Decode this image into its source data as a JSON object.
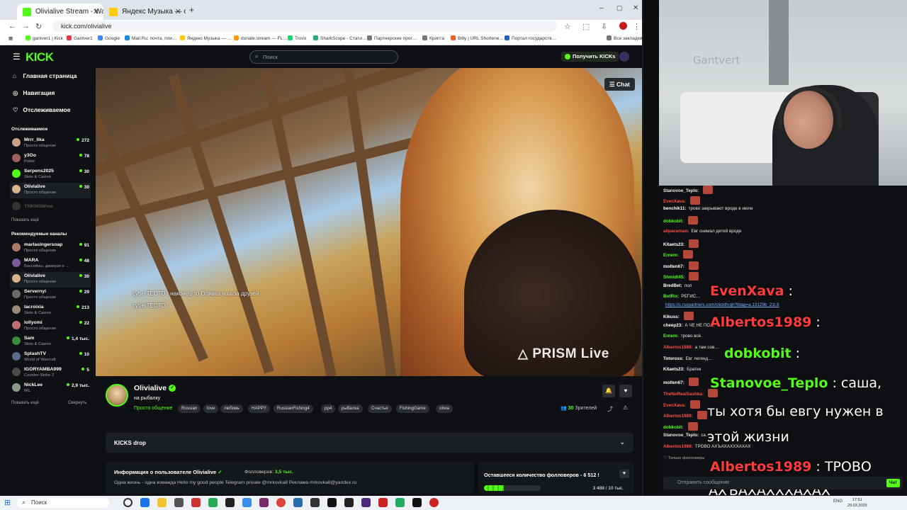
{
  "browser": {
    "tabs": [
      {
        "title": "Olivialive Stream - Watch Live …",
        "active": true
      },
      {
        "title": "Яндекс Музыка — собираем …",
        "active": false
      }
    ],
    "url": "kick.com/olivialive",
    "bookmarks": [
      "gantver1 | Kick",
      "Gantver1",
      "Google",
      "Mail.Ru: почта, пои…",
      "Яндекс Музыка — …",
      "donate.stream — FL…",
      "Trovo",
      "SharkScope - Стати…",
      "Партнерские прог…",
      "Крипта",
      "Bitly | URL Shortene…",
      "Портал государств…",
      "Все закладки"
    ]
  },
  "kick": {
    "logo": "KICK",
    "search_placeholder": "Поиск",
    "get_kicks": "Получить KICKs"
  },
  "sidebar": {
    "nav": [
      {
        "label": "Главная страница",
        "icon": "home-icon"
      },
      {
        "label": "Навигация",
        "icon": "compass-icon"
      },
      {
        "label": "Отслеживаемое",
        "icon": "heart-icon"
      }
    ],
    "following_header": "Отслеживаемое",
    "following": [
      {
        "name": "Mrrr_lika",
        "category": "Просто общение",
        "viewers": "272"
      },
      {
        "name": "у3Оо",
        "category": "Poker",
        "viewers": "78"
      },
      {
        "name": "Serpens2025",
        "category": "Slots & Casino",
        "viewers": "30"
      },
      {
        "name": "Olivialive",
        "category": "Просто общение",
        "viewers": "30"
      },
      {
        "name": "YNKNOWme",
        "category": "",
        "viewers": ""
      }
    ],
    "show_more": "Показать ещё",
    "recommended_header": "Рекомендуемые каналы",
    "recommended": [
      {
        "name": "marlasingersoap",
        "category": "Просто общение",
        "viewers": "91"
      },
      {
        "name": "MARA",
        "category": "Бассейны, джакузи и …",
        "viewers": "48"
      },
      {
        "name": "Olivialive",
        "category": "Просто общение",
        "viewers": "30"
      },
      {
        "name": "Servernyi",
        "category": "Просто общение",
        "viewers": "29"
      },
      {
        "name": "lacroixia",
        "category": "Slots & Casino",
        "viewers": "213"
      },
      {
        "name": "lollyomi",
        "category": "Просто общение",
        "viewers": "22"
      },
      {
        "name": "Sam",
        "category": "Slots & Casino",
        "viewers": "1,4 тыс."
      },
      {
        "name": "SplashTV",
        "category": "World of Warcraft",
        "viewers": "10"
      },
      {
        "name": "IGORYAMBA999",
        "category": "Counter-Strike 2",
        "viewers": "5"
      },
      {
        "name": "NickLee",
        "category": "IRL",
        "viewers": "2,9 тыс."
      }
    ],
    "show_more_2": "Показать ещё",
    "collapse": "Свернуть"
  },
  "video": {
    "chat_button": "Chat",
    "overlay_lines": [
      "cyberTECTO : наконец-то Оливка нашла друзей",
      "cyberTECTO :"
    ],
    "watermark": "PRISM Live"
  },
  "channel": {
    "name": "Olivialive",
    "title": "на рыбалку",
    "category": "Просто общение",
    "tags": [
      "Russian",
      "love",
      "любовь",
      "HAPPY",
      "RussianFishing4",
      "pp4",
      "рыбалка",
      "Счастье",
      "FishingGame",
      "olivia"
    ],
    "viewers_count": "30",
    "viewers_label": "Зрителей",
    "kicks_drop": "KICKS drop",
    "about_title": "Информация о пользователе Olivialive",
    "followers_label": "Фолловеров:",
    "followers_value": "3,5 тыс.",
    "about_desc": "Одна жизнь - одна команда Hello my good people   Telegram private @mrkovka8 Реклама mrkovka8@yandex.ru",
    "goal_title": "Оставшееся количество фолловеров - 6 512 !",
    "goal_progress": 0.35,
    "goal_count": "3 488 / 10 тыс."
  },
  "webcam": {
    "wall_text": "Gantvert"
  },
  "chat": {
    "messages": [
      {
        "user": "Stanovoe_Teplo:",
        "text": "",
        "color": "#e8e8e8",
        "emote": true
      },
      {
        "user": "EvenXava:",
        "text": "",
        "color": "#ff4d4d",
        "emote": true
      },
      {
        "user": "benchik11:",
        "text": "трово закрывают вроде в июле",
        "color": "#ffffff",
        "emote": false
      },
      {
        "user": "dobkobit:",
        "text": "",
        "color": "#53fc18",
        "emote": true
      },
      {
        "user": "alipaceman:",
        "text": "Евг снимал детей вроде",
        "color": "#ff4d4d",
        "emote": false
      },
      {
        "user": "Kitaets23:",
        "text": "",
        "color": "#ffffff",
        "emote": true
      },
      {
        "user": "Ernem:",
        "text": "",
        "color": "#53fc18",
        "emote": true
      },
      {
        "user": "molten67:",
        "text": "",
        "color": "#ffffff",
        "emote": true
      },
      {
        "user": "Shmidt45:",
        "text": "",
        "color": "#53fc18",
        "emote": true
      },
      {
        "user": "BredBet:",
        "text": "лол",
        "color": "#ffffff",
        "emote": false
      },
      {
        "user": "BotRix:",
        "text": "РЕГИС…",
        "color": "#53fc18",
        "emote": false
      },
      {
        "user": "",
        "text": "https://c.rsopartners.com/clickthrgh?btag=a.13129b_21l.9",
        "color": "#7fb2ff",
        "emote": false
      },
      {
        "user": "Kikuss:",
        "text": "",
        "color": "#ffffff",
        "emote": true
      },
      {
        "user": "cheep23:",
        "text": "А ЧЕ НЕ ПО…",
        "color": "#ffffff",
        "emote": false
      },
      {
        "user": "Ernem:",
        "text": "трово всё.",
        "color": "#53fc18",
        "emote": false
      },
      {
        "user": "Albertos1989:",
        "text": "а там сов…",
        "color": "#ff4d4d",
        "emote": false
      },
      {
        "user": "Totoross:",
        "text": "Евг легенд…",
        "color": "#ffffff",
        "emote": false
      },
      {
        "user": "Kitaets23:",
        "text": "Братик",
        "color": "#ffffff",
        "emote": false
      },
      {
        "user": "molten67:",
        "text": "",
        "color": "#ffffff",
        "emote": true
      },
      {
        "user": "TheNoRealSashka:",
        "text": "",
        "color": "#ff4d4d",
        "emote": true
      },
      {
        "user": "EvenXava:",
        "text": "",
        "color": "#ff4d4d",
        "emote": true
      },
      {
        "user": "Albertos1989:",
        "text": "",
        "color": "#ff4d4d",
        "emote": true
      },
      {
        "user": "dobkobit:",
        "text": "",
        "color": "#53fc18",
        "emote": true
      },
      {
        "user": "Stanovoe_Teplo:",
        "text": "са…",
        "color": "#e8e8e8",
        "emote": false
      },
      {
        "user": "Albertos1989:",
        "text": "ТРОВО АХЪАХАХХХАХАХ",
        "color": "#ff4d4d",
        "emote": false
      }
    ],
    "overlay": [
      {
        "user": "EvenXava",
        "text": ":",
        "color": "#ff3b3b"
      },
      {
        "user": "Albertos1989",
        "text": ":",
        "color": "#ff3b3b"
      },
      {
        "user": "dobkobit",
        "text": ":",
        "color": "#53fc18"
      },
      {
        "user": "Stanovoe_Teplo",
        "text": ": саша,",
        "color": "#53fc18"
      },
      {
        "user": "",
        "text": "ты хотя бы евгу нужен в",
        "color": "#ffffff"
      },
      {
        "user": "",
        "text": "этой жизни",
        "color": "#ffffff"
      },
      {
        "user": "Albertos1989",
        "text": ": ТРОВО",
        "color": "#ff3b3b"
      },
      {
        "user": "",
        "text": "АХЪАХАХХХАХАХ",
        "color": "#ffffff"
      }
    ],
    "followers_only": "Только фолловеры",
    "input_placeholder": "Отправить сообщение",
    "send_label": "Чат"
  },
  "taskbar": {
    "search": "Поиск",
    "time": "17:51",
    "date": "29.03.2025",
    "lang": "ENG"
  },
  "colors": {
    "accent": "#53fc18",
    "bg": "#0e1013",
    "panel": "#1b1e22"
  }
}
